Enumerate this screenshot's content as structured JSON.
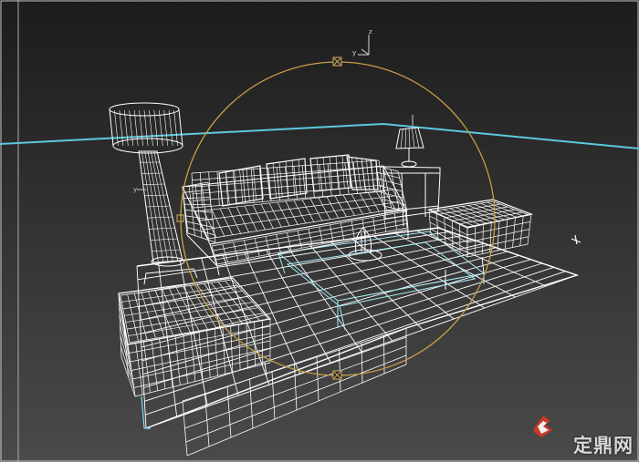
{
  "viewport": {
    "background_top": "#1c1c1c",
    "background_bottom": "#4a4a4a",
    "horizon_color": "#5cc9de",
    "wire_color": "#ffffff",
    "selection_wire_color": "#7ee0ef",
    "gizmo_color": "#c8a046",
    "view_type": "perspective"
  },
  "gizmo": {
    "axis_labels": {
      "z": "z",
      "y": "y"
    }
  },
  "scene_objects": [
    {
      "name": "sofa",
      "kind": "three-seat sofa with cushions"
    },
    {
      "name": "floor-lamp",
      "kind": "floor lamp with drum shade"
    },
    {
      "name": "table-lamp",
      "kind": "table lamp"
    },
    {
      "name": "side-table",
      "kind": "side table"
    },
    {
      "name": "ottoman-front",
      "kind": "ottoman"
    },
    {
      "name": "ottoman-right",
      "kind": "ottoman"
    },
    {
      "name": "coffee-table",
      "kind": "glass coffee table"
    },
    {
      "name": "rug",
      "kind": "floor rug grid"
    }
  ],
  "watermark": {
    "text": "定鼎网",
    "logo_icon": "s-logo-icon"
  }
}
